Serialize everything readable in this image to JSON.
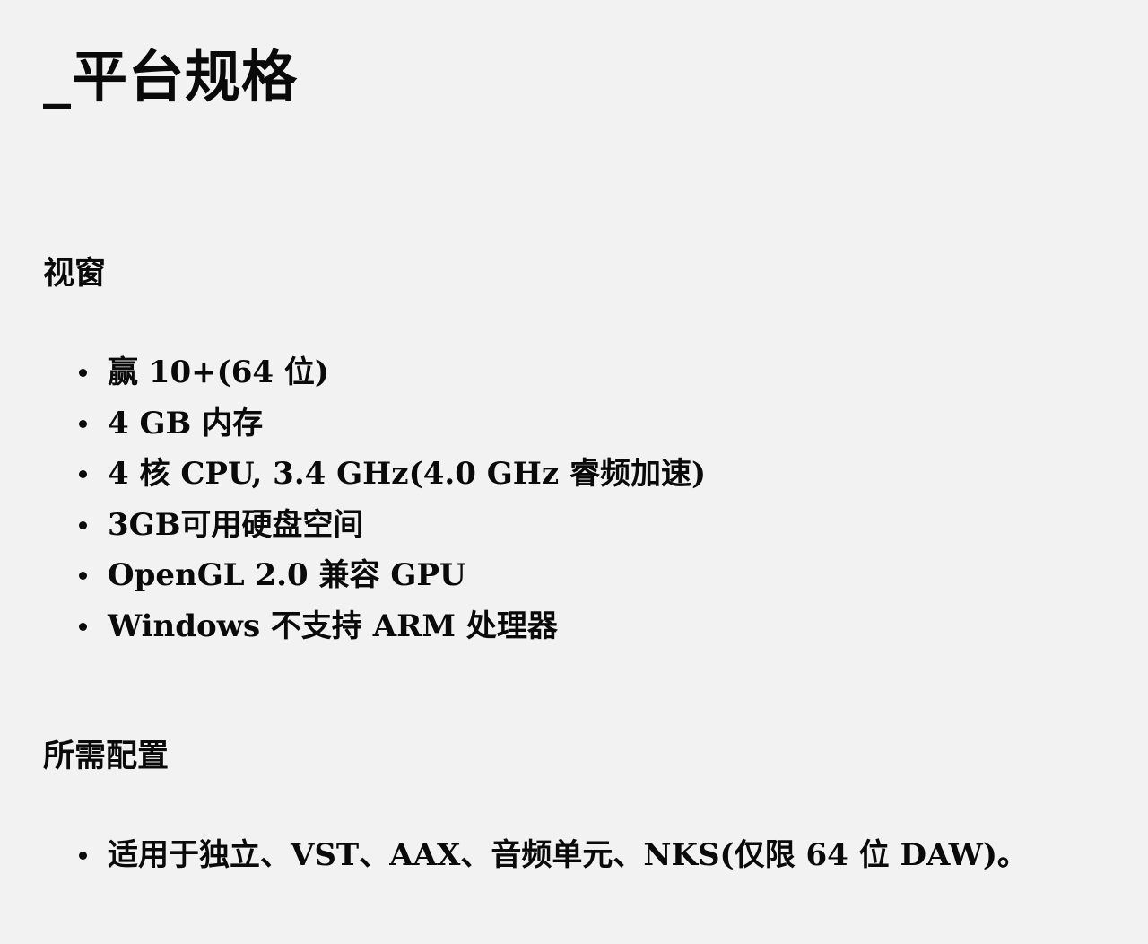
{
  "title": "_平台规格",
  "sections": {
    "windows": {
      "heading": "视窗",
      "items": [
        "赢 10+(64 位)",
        "4 GB 内存",
        "4 核 CPU, 3.4 GHz(4.0 GHz 睿频加速)",
        "3GB可用硬盘空间",
        "OpenGL 2.0 兼容 GPU",
        "Windows 不支持 ARM 处理器"
      ]
    },
    "requirements": {
      "heading": "所需配置",
      "items": [
        "适用于独立、VST、AAX、音频单元、NKS(仅限 64 位 DAW)。"
      ]
    }
  }
}
